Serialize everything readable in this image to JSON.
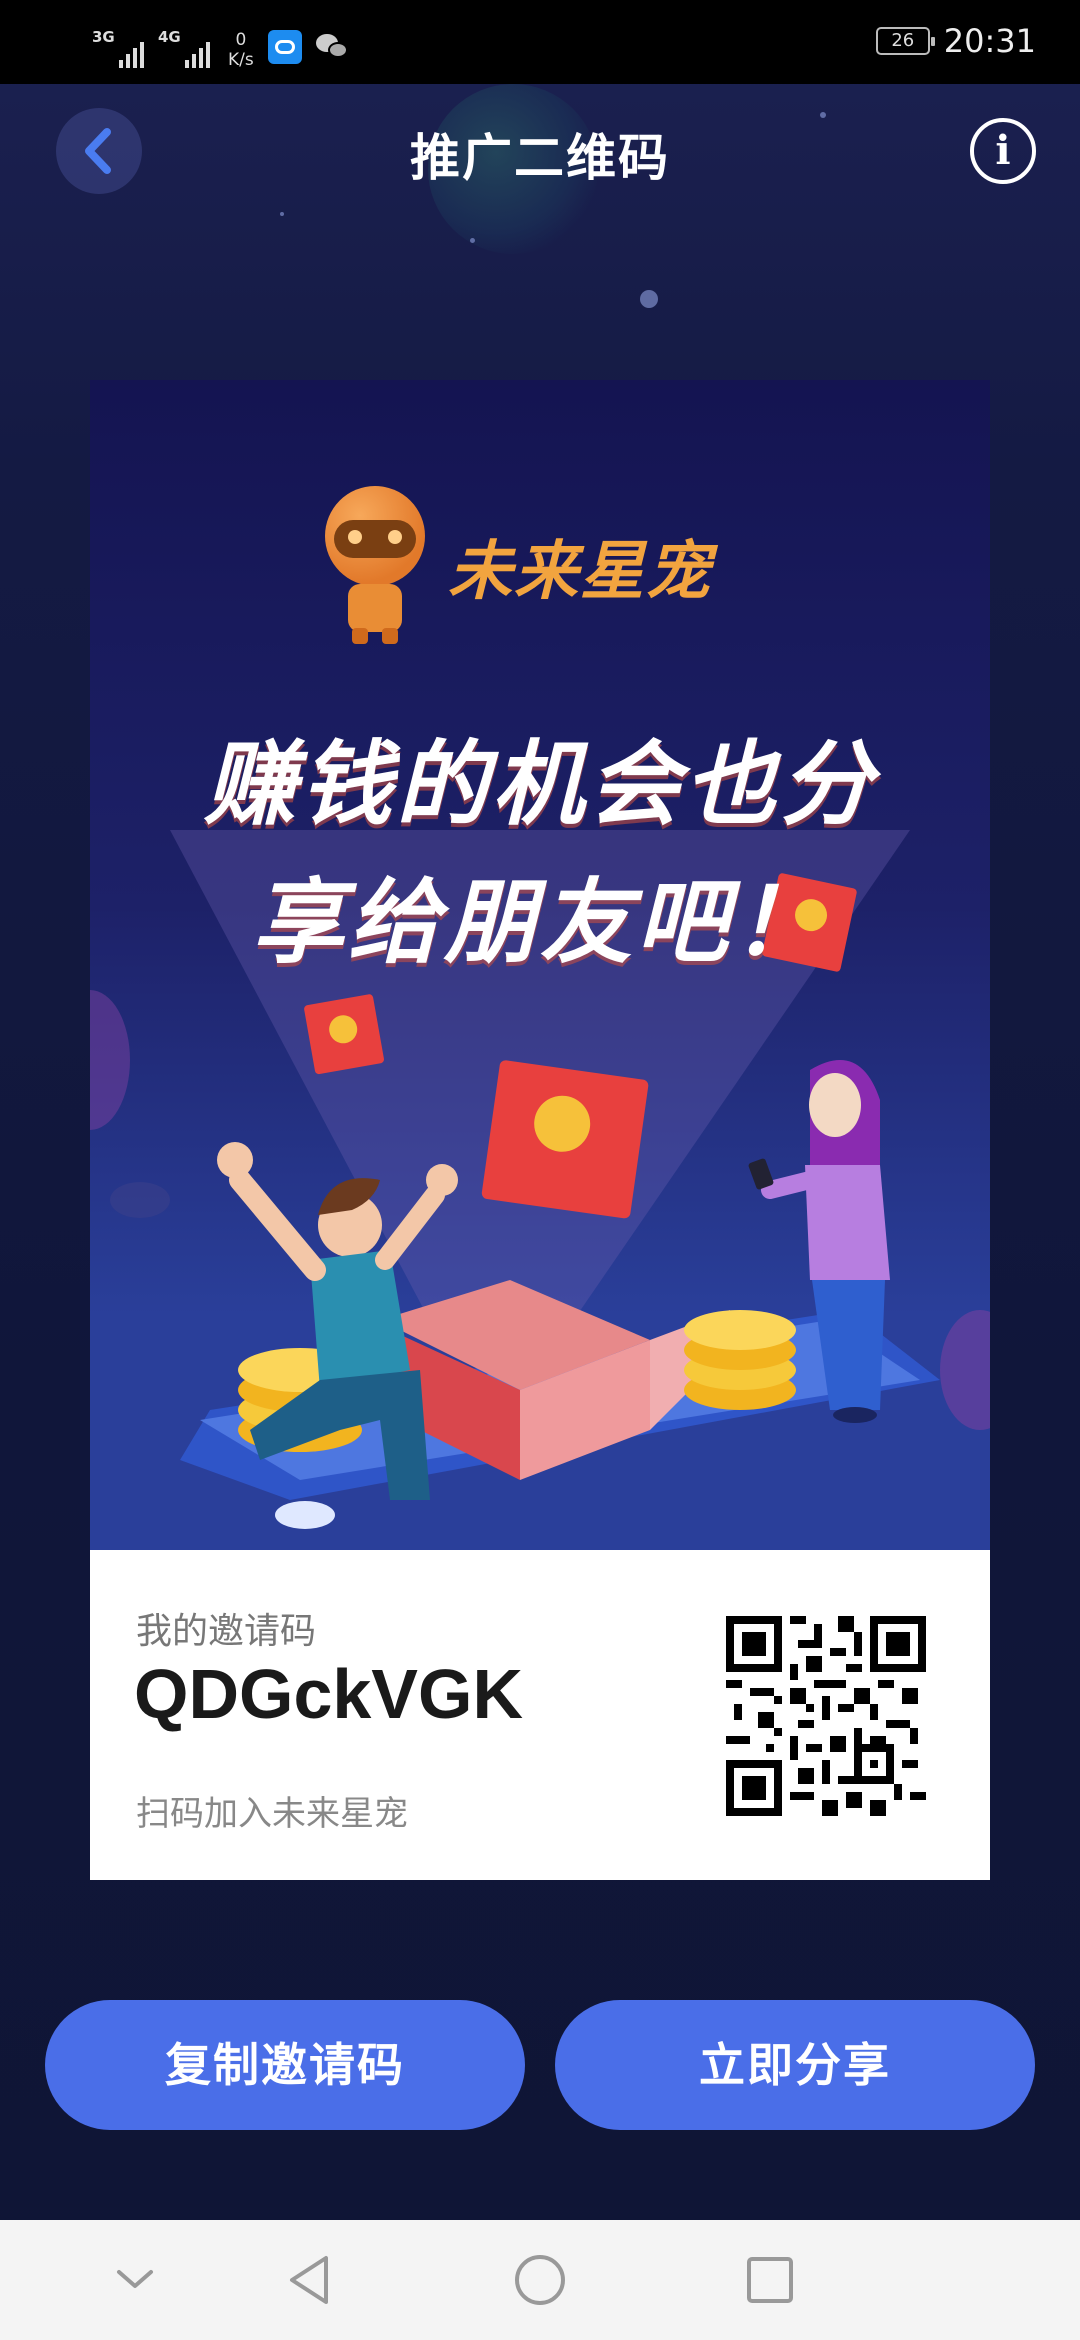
{
  "status_bar": {
    "signal1_type": "3G",
    "signal2_type": "4G",
    "net_speed_value": "0",
    "net_speed_unit": "K/s",
    "battery": "26",
    "time": "20:31"
  },
  "header": {
    "title": "推广二维码",
    "info_icon": "i"
  },
  "poster": {
    "brand_name": "未来星宠",
    "slogan_line1": "赚钱的机会也分",
    "slogan_line2": "享给朋友吧！"
  },
  "invite": {
    "label": "我的邀请码",
    "code": "QDGckVGK",
    "hint": "扫码加入未来星宠"
  },
  "actions": {
    "copy_label": "复制邀请码",
    "share_label": "立即分享"
  },
  "colors": {
    "accent": "#4a6ee8",
    "brand_orange": "#f2a43f",
    "background": "#10163a"
  },
  "icons": {
    "back": "chevron-left-icon",
    "info": "info-icon",
    "nav": [
      "chevron-down-icon",
      "triangle-back-icon",
      "circle-home-icon",
      "square-recents-icon"
    ]
  }
}
